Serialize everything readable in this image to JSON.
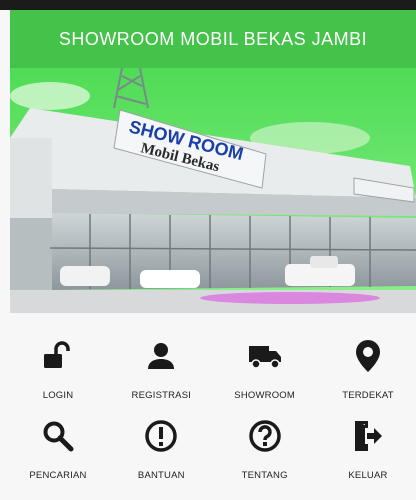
{
  "app": {
    "title": "SHOWROOM MOBIL BEKAS JAMBI",
    "accent": "#45c24a"
  },
  "banner": {
    "sign_line1": "SHOW ROOM",
    "sign_line2": "Mobil Bekas"
  },
  "menu": {
    "row1": [
      {
        "label": "LOGIN",
        "icon": "lock-open-icon"
      },
      {
        "label": "REGISTRASI",
        "icon": "person-icon"
      },
      {
        "label": "SHOWROOM",
        "icon": "truck-icon"
      },
      {
        "label": "TERDEKAT",
        "icon": "location-pin-icon"
      }
    ],
    "row2": [
      {
        "label": "PENCARIAN",
        "icon": "search-icon"
      },
      {
        "label": "BANTUAN",
        "icon": "alert-circle-icon"
      },
      {
        "label": "TENTANG",
        "icon": "help-circle-icon"
      },
      {
        "label": "KELUAR",
        "icon": "exit-icon"
      }
    ]
  }
}
